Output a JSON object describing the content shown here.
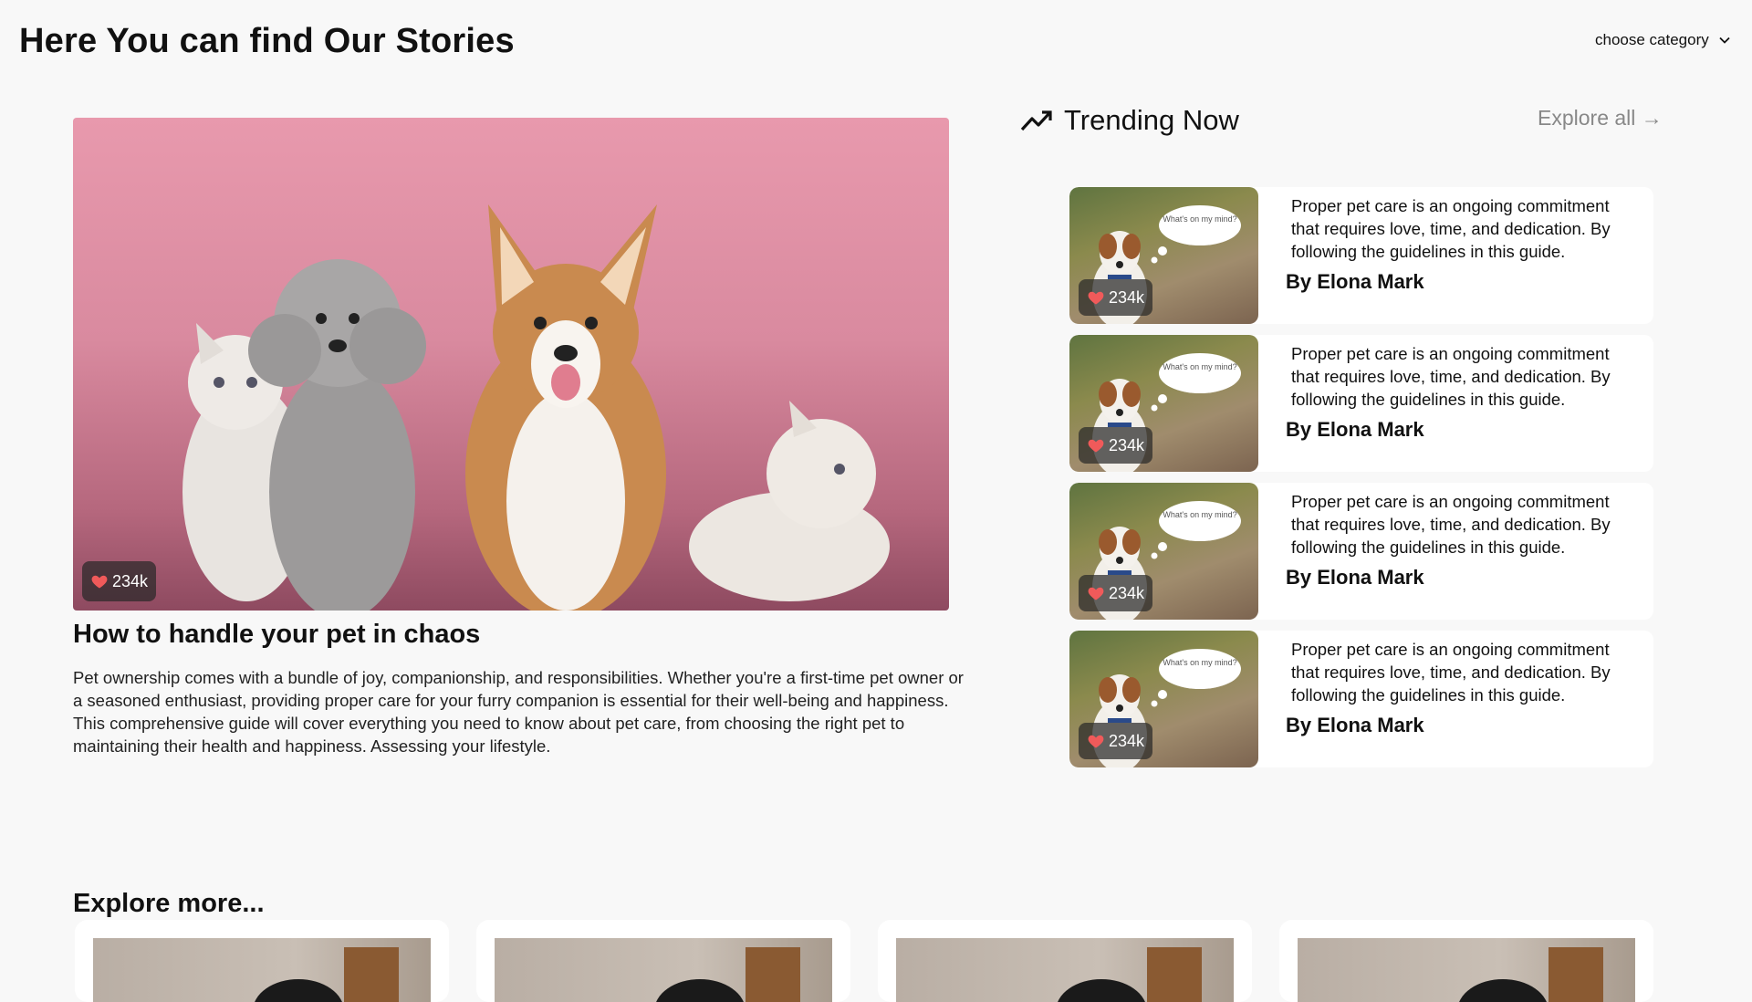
{
  "header": {
    "title": "Here You can find Our Stories",
    "category_select": "choose category"
  },
  "featured": {
    "likes": "234k",
    "title": "How to handle your pet in chaos",
    "text": "Pet ownership comes with a bundle of joy, companionship, and responsibilities. Whether you're a first-time pet owner or a seasoned enthusiast, providing proper care for your furry companion is essential for their well-being and happiness. This comprehensive guide will cover everything you need to know about pet care, from choosing the right pet to maintaining their health and happiness. Assessing your lifestyle."
  },
  "trending": {
    "title": "Trending Now",
    "explore_all": "Explore all →",
    "thought_bubble": "What's on my mind?",
    "items": [
      {
        "likes": "234k",
        "text": "Proper pet care is an ongoing commitment that requires love, time, and dedication. By following the guidelines in this guide.",
        "author": "By Elona Mark"
      },
      {
        "likes": "234k",
        "text": "Proper pet care is an ongoing commitment that requires love, time, and dedication. By following the guidelines in this guide.",
        "author": "By Elona Mark"
      },
      {
        "likes": "234k",
        "text": "Proper pet care is an ongoing commitment that requires love, time, and dedication. By following the guidelines in this guide.",
        "author": "By Elona Mark"
      },
      {
        "likes": "234k",
        "text": "Proper pet care is an ongoing commitment that requires love, time, and dedication. By following the guidelines in this guide.",
        "author": "By Elona Mark"
      }
    ]
  },
  "explore_more": {
    "title": "Explore more..."
  },
  "icons": {
    "trending": "trending-up-icon",
    "like": "heart-icon",
    "dropdown": "chevron-down-icon"
  },
  "colors": {
    "heart": "#f05a5a",
    "muted_link": "#888888"
  }
}
